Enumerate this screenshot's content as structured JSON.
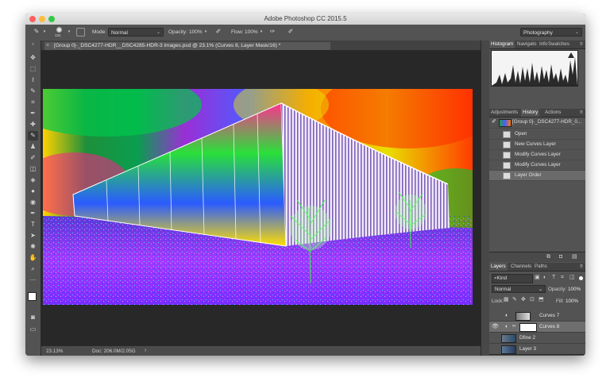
{
  "app": {
    "title": "Adobe Photoshop CC 2015.5",
    "workspace": "Photography"
  },
  "options_bar": {
    "brush_size": "131",
    "mode_label": "Mode:",
    "mode_value": "Normal",
    "opacity_label": "Opacity:",
    "opacity_value": "100%",
    "flow_label": "Flow:",
    "flow_value": "100%"
  },
  "document": {
    "tab_title": "[Group 0]-_DSC4277-HDR__DSC4285-HDR-3 images.psd @ 23.1% (Curves 8, Layer Mask/16) *",
    "zoom": "23.13%",
    "doc_size": "Doc: 206.0M/2.05G"
  },
  "panels": {
    "histogram_tabs": [
      "Histogram",
      "Navigato",
      "Info",
      "Swatches"
    ],
    "history_tabs": [
      "Adjustments",
      "History",
      "Actions"
    ],
    "history_snapshot": "[Group 0]-_DSC4277-HDR_0...",
    "history_items": [
      "Open",
      "New Curves Layer",
      "Modify Curves Layer",
      "Modify Curves Layer",
      "Layer Order"
    ],
    "layers_tabs": [
      "Layers",
      "Channels",
      "Paths"
    ],
    "filter_kind": "Kind",
    "blend_mode": "Normal",
    "opacity_label": "Opacity:",
    "opacity_value": "100%",
    "lock_label": "Lock:",
    "fill_label": "Fill:",
    "fill_value": "100%",
    "layers": [
      "Curves 7",
      "Curves 8",
      "Dfine 2",
      "Layer 3"
    ]
  },
  "icons": {
    "traffic_lights": [
      "#fc605c",
      "#fdbc40",
      "#34c84a"
    ]
  }
}
